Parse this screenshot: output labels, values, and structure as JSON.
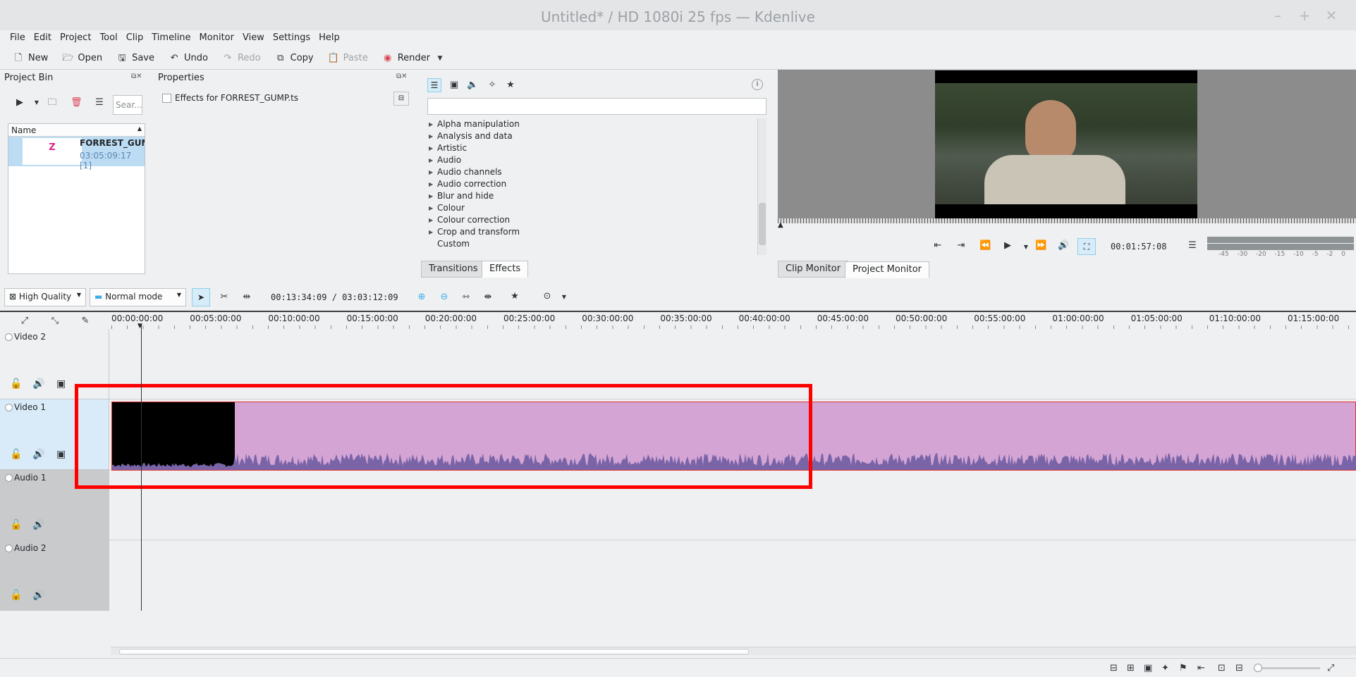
{
  "window": {
    "title": "Untitled* / HD 1080i 25 fps — Kdenlive",
    "min": "–",
    "max": "+",
    "close": "✕"
  },
  "menu": [
    "File",
    "Edit",
    "Project",
    "Tool",
    "Clip",
    "Timeline",
    "Monitor",
    "View",
    "Settings",
    "Help"
  ],
  "toolbar": {
    "new": "New",
    "open": "Open",
    "save": "Save",
    "undo": "Undo",
    "redo": "Redo",
    "copy": "Copy",
    "paste": "Paste",
    "render": "Render"
  },
  "project_bin": {
    "title": "Project Bin",
    "search_placeholder": "Sear...",
    "column_name": "Name",
    "clip": {
      "name": "FORREST_GUMP",
      "duration": "03:05:09:17",
      "count": "[1]"
    }
  },
  "properties": {
    "title": "Properties",
    "effects_for": "Effects for FORREST_GUMP.ts"
  },
  "effects": {
    "categories": [
      "Alpha manipulation",
      "Analysis and data",
      "Artistic",
      "Audio",
      "Audio channels",
      "Audio correction",
      "Blur and hide",
      "Colour",
      "Colour correction",
      "Crop and transform",
      "Custom"
    ],
    "tab_transitions": "Transitions",
    "tab_effects": "Effects"
  },
  "monitor": {
    "timecode": "00:01:57:08",
    "tab_clip": "Clip Monitor",
    "tab_project": "Project Monitor",
    "meter_labels": [
      "-45",
      "-30",
      "-20",
      "-15",
      "-10",
      "-5",
      "-2",
      "0"
    ]
  },
  "timeline_toolbar": {
    "quality": "High Quality",
    "mode": "Normal mode",
    "position": "00:13:34:09 / 03:03:12:09"
  },
  "ruler": [
    "00:00:00:00",
    "00:05:00:00",
    "00:10:00:00",
    "00:15:00:00",
    "00:20:00:00",
    "00:25:00:00",
    "00:30:00:00",
    "00:35:00:00",
    "00:40:00:00",
    "00:45:00:00",
    "00:50:00:00",
    "00:55:00:00",
    "01:00:00:00",
    "01:05:00:00",
    "01:10:00:00",
    "01:15:00:00"
  ],
  "tracks": [
    "Video 2",
    "Video 1",
    "Audio 1",
    "Audio 2"
  ],
  "colors": {
    "clip": "#d4a5d4",
    "waveform": "#7a64a8",
    "highlight": "#ff0000",
    "selection": "#bcdcf4"
  }
}
